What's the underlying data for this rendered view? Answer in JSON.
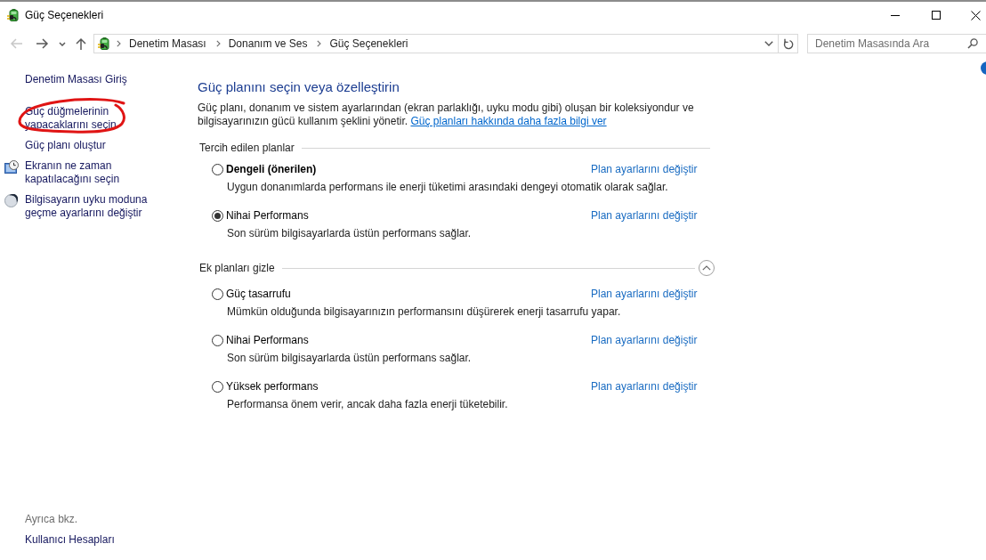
{
  "window": {
    "title": "Güç Seçenekleri"
  },
  "navigation": {
    "buttons": [
      {
        "kind": "back",
        "disabled": true
      },
      {
        "kind": "forward",
        "disabled": false
      },
      {
        "kind": "recent",
        "disabled": false
      },
      {
        "kind": "up",
        "disabled": false
      }
    ]
  },
  "address_bar": {
    "breadcrumbs": [
      "Denetim Masası",
      "Donanım ve Ses",
      "Güç Seçenekleri"
    ]
  },
  "search": {
    "placeholder": "Denetim Masasında Ara"
  },
  "sidebar": {
    "home_link": "Denetim Masası Giriş",
    "tasks": [
      {
        "label": "Güç düğmelerinin yapacaklarını seçin",
        "kind": "plain",
        "annotated": true
      },
      {
        "label": "Güç planı oluştur",
        "kind": "plain",
        "annotated": false
      },
      {
        "label": "Ekranın ne zaman kapatılacağını seçin",
        "kind": "display",
        "annotated": false
      },
      {
        "label": "Bilgisayarın uyku moduna geçme ayarlarını değiştir",
        "kind": "sleep",
        "annotated": false
      }
    ],
    "see_also": {
      "heading": "Ayrıca bkz.",
      "links": [
        "Kullanıcı Hesapları"
      ]
    }
  },
  "main": {
    "heading": "Güç planını seçin veya özelleştirin",
    "description": "Güç planı, donanım ve sistem ayarlarından (ekran parlaklığı, uyku modu gibi) oluşan bir koleksiyondur ve bilgisayarınızın gücü kullanım şeklini yönetir.",
    "more_info_link": "Güç planları hakkında daha fazla bilgi ver",
    "plan_groups": [
      {
        "title": "Tercih edilen planlar",
        "kind": "fixed",
        "plans": [
          {
            "name": "Dengeli (önerilen)",
            "recommended": true,
            "selected": false,
            "settings_link": "Plan ayarlarını değiştir",
            "description": "Uygun donanımlarda performans ile enerji tüketimi arasındaki dengeyi otomatik olarak sağlar."
          },
          {
            "name": "Nihai Performans",
            "recommended": false,
            "selected": true,
            "settings_link": "Plan ayarlarını değiştir",
            "description": "Son sürüm bilgisayarlarda üstün performans sağlar."
          }
        ]
      },
      {
        "title": "Ek planları gizle",
        "kind": "toggle",
        "expanded": true,
        "plans": [
          {
            "name": "Güç tasarrufu",
            "recommended": false,
            "selected": false,
            "settings_link": "Plan ayarlarını değiştir",
            "description": "Mümkün olduğunda bilgisayarınızın performansını düşürerek enerji tasarrufu yapar."
          },
          {
            "name": "Nihai Performans",
            "recommended": false,
            "selected": false,
            "settings_link": "Plan ayarlarını değiştir",
            "description": "Son sürüm bilgisayarlarda üstün performans sağlar."
          },
          {
            "name": "Yüksek performans",
            "recommended": false,
            "selected": false,
            "settings_link": "Plan ayarlarını değiştir",
            "description": "Performansa önem verir, ancak daha fazla enerji tüketebilir."
          }
        ]
      }
    ]
  }
}
